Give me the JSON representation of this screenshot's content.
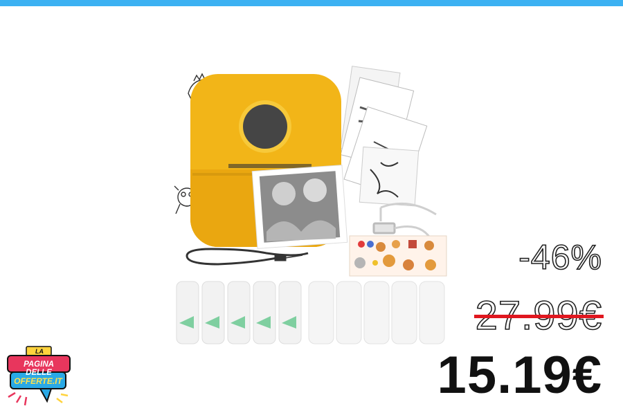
{
  "product": {
    "icon": "thermal-printer-product-image",
    "colors": {
      "printer_body": "#f2b518",
      "accent_bar": "#3cb1f2"
    }
  },
  "price": {
    "discount": "-46%",
    "old_price": "27.99€",
    "new_price": "15.19€",
    "strike_color": "#e0171f"
  },
  "logo": {
    "line1": "LA",
    "line2": "PAGINA DELLE",
    "line3": "OFFERTE.IT"
  }
}
